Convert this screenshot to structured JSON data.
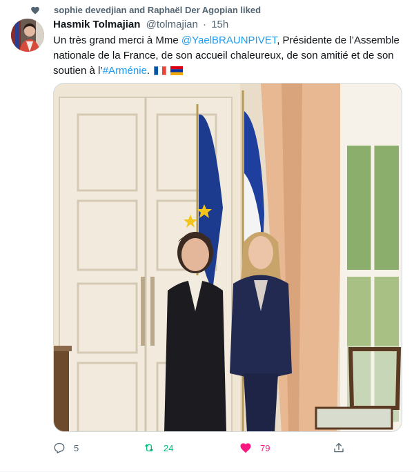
{
  "social_context": {
    "text": "sophie devedjian and Raphaël Der Agopian liked"
  },
  "tweet": {
    "author_name": "Hasmik Tolmajian",
    "author_handle": "@tolmajian",
    "separator": "·",
    "time": "15h",
    "text_part1": "Un très grand merci à Mme ",
    "mention": "@YaelBRAUNPIVET",
    "text_part2": ", Présidente de l’Assemble nationale de la France, de son accueil chaleureux, de son amitié et de son soutien à l’",
    "hashtag": "#Arménie",
    "text_part3": ".",
    "flags": [
      "France flag",
      "Armenia flag"
    ]
  },
  "actions": {
    "reply_count": "5",
    "retweet_count": "24",
    "like_count": "79"
  },
  "colors": {
    "link": "#1d9bf0",
    "retweet_active": "#00ba7c",
    "like_active": "#f91880",
    "secondary_text": "#536471"
  },
  "icons": [
    "heart-icon",
    "reply-icon",
    "retweet-icon",
    "like-icon",
    "share-icon"
  ]
}
